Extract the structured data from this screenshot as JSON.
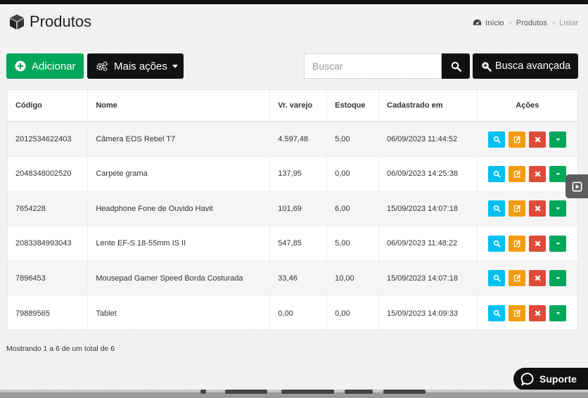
{
  "header": {
    "title": "Produtos",
    "breadcrumb": [
      "Início",
      "Produtos",
      "Listar"
    ]
  },
  "toolbar": {
    "add_label": "Adicionar",
    "more_actions_label": "Mais ações",
    "search_placeholder": "Buscar",
    "advanced_search_label": "Busca avançada"
  },
  "table": {
    "columns": [
      "Código",
      "Nome",
      "Vr. varejo",
      "Estoque",
      "Cadastrado em",
      "Ações"
    ],
    "rows": [
      {
        "codigo": "2012534622403",
        "nome": "Câmera EOS Rebel T7",
        "vr_varejo": "4.597,48",
        "estoque": "5,00",
        "cadastrado": "06/09/2023 11:44:52"
      },
      {
        "codigo": "2048348002520",
        "nome": "Carpete grama",
        "vr_varejo": "137,95",
        "estoque": "0,00",
        "cadastrado": "06/09/2023 14:25:38"
      },
      {
        "codigo": "7654228",
        "nome": "Headphone Fone de Ouvido Havit",
        "vr_varejo": "101,69",
        "estoque": "6,00",
        "cadastrado": "15/09/2023 14:07:18"
      },
      {
        "codigo": "2083384993043",
        "nome": "Lente EF-S 18-55mm IS II",
        "vr_varejo": "547,85",
        "estoque": "5,00",
        "cadastrado": "06/09/2023 11:48:22"
      },
      {
        "codigo": "7896453",
        "nome": "Mousepad Gamer Speed Borda Costurada",
        "vr_varejo": "33,46",
        "estoque": "10,00",
        "cadastrado": "15/09/2023 14:07:18"
      },
      {
        "codigo": "79889565",
        "nome": "Tablet",
        "vr_varejo": "0,00",
        "estoque": "0,00",
        "cadastrado": "15/09/2023 14:09:33"
      }
    ]
  },
  "footer": {
    "info": "Mostrando 1 a 6 de um total de 6"
  },
  "support": {
    "label": "Suporte"
  },
  "colors": {
    "success": "#00a65a",
    "info": "#00c0ef",
    "warning": "#f39c12",
    "danger": "#dd4b39",
    "dark": "#111111"
  },
  "icons": {
    "title": "cube-icon",
    "breadcrumb_home": "dashboard-icon",
    "add": "plus-circle-icon",
    "more": "gears-icon",
    "search": "search-icon",
    "advanced_search": "search-plus-icon",
    "row_actions": [
      "search-icon",
      "edit-icon",
      "close-icon",
      "caret-down-icon"
    ],
    "side_tab": "play-square-icon",
    "support": "chat-bubble-icon"
  }
}
